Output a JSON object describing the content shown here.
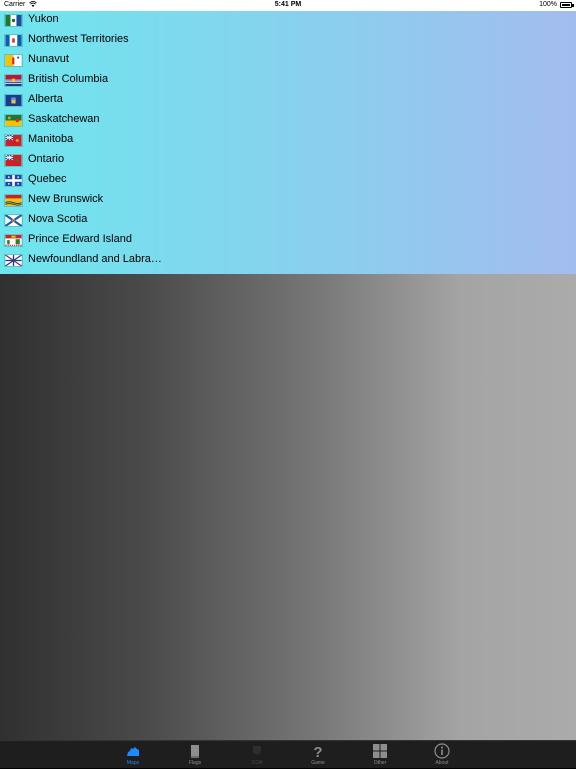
{
  "status_bar": {
    "carrier": "Carrier",
    "time": "5:41 PM",
    "battery_percent": "100%"
  },
  "provinces": [
    {
      "name": "Yukon",
      "flag_icon": "yukon-flag-icon"
    },
    {
      "name": "Northwest Territories",
      "flag_icon": "northwest-territories-flag-icon"
    },
    {
      "name": "Nunavut",
      "flag_icon": "nunavut-flag-icon"
    },
    {
      "name": "British Columbia",
      "flag_icon": "british-columbia-flag-icon"
    },
    {
      "name": "Alberta",
      "flag_icon": "alberta-flag-icon"
    },
    {
      "name": "Saskatchewan",
      "flag_icon": "saskatchewan-flag-icon"
    },
    {
      "name": "Manitoba",
      "flag_icon": "manitoba-flag-icon"
    },
    {
      "name": "Ontario",
      "flag_icon": "ontario-flag-icon"
    },
    {
      "name": "Quebec",
      "flag_icon": "quebec-flag-icon"
    },
    {
      "name": "New Brunswick",
      "flag_icon": "new-brunswick-flag-icon"
    },
    {
      "name": "Nova Scotia",
      "flag_icon": "nova-scotia-flag-icon"
    },
    {
      "name": "Prince Edward Island",
      "flag_icon": "prince-edward-island-flag-icon"
    },
    {
      "name": "Newfoundland and Labra…",
      "flag_icon": "newfoundland-flag-icon"
    }
  ],
  "tab_bar": {
    "tabs": [
      {
        "label": "Maps",
        "icon": "map-icon",
        "selected": true
      },
      {
        "label": "Flags",
        "icon": "flag-icon",
        "selected": false
      },
      {
        "label": "COA",
        "icon": "coat-of-arms-icon",
        "selected": false,
        "disabled": true
      },
      {
        "label": "Game",
        "icon": "question-mark-icon",
        "selected": false
      },
      {
        "label": "Other",
        "icon": "grid-icon",
        "selected": false
      },
      {
        "label": "About",
        "icon": "info-icon",
        "selected": false
      }
    ]
  },
  "colors": {
    "selected_tab": "#1a8cff",
    "unselected_tab": "#8e8e8e"
  }
}
